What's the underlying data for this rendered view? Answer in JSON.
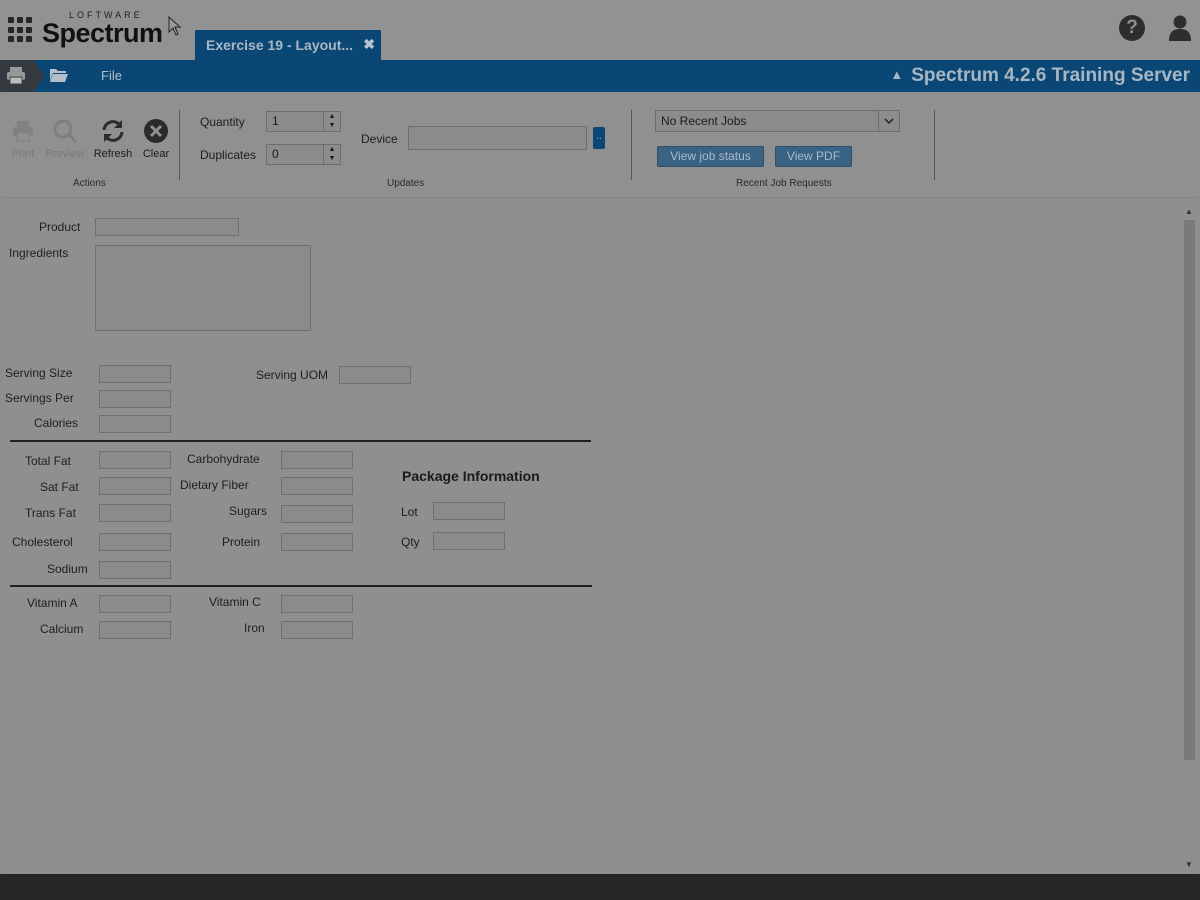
{
  "header": {
    "logo_small": "LOFTWARE",
    "logo_main": "Spectrum",
    "tab_title": "Exercise 19 - Layout...",
    "tab_close": "✖",
    "help_glyph": "?"
  },
  "ribbon": {
    "file_label": "File",
    "server_title": "Spectrum 4.2.6 Training Server",
    "collapse_glyph": "^"
  },
  "toolbar": {
    "actions": {
      "print_label": "Print",
      "preview_label": "Preview",
      "refresh_label": "Refresh",
      "clear_label": "Clear",
      "group_label": "Actions"
    },
    "updates": {
      "quantity_label": "Quantity",
      "quantity_value": "1",
      "duplicates_label": "Duplicates",
      "duplicates_value": "0",
      "device_label": "Device",
      "device_browse": "..",
      "group_label": "Updates"
    },
    "recent": {
      "selected": "No Recent Jobs",
      "view_status": "View job status",
      "view_pdf": "View PDF",
      "group_label": "Recent Job Requests"
    }
  },
  "form": {
    "product": "Product",
    "ingredients": "Ingredients",
    "serving_size": "Serving Size",
    "serving_uom": "Serving UOM",
    "servings_per": "Servings Per",
    "calories": "Calories",
    "total_fat": "Total Fat",
    "carbohydrate": "Carbohydrate",
    "sat_fat": "Sat Fat",
    "dietary_fiber": "Dietary Fiber",
    "trans_fat": "Trans Fat",
    "sugars": "Sugars",
    "cholesterol": "Cholesterol",
    "protein": "Protein",
    "sodium": "Sodium",
    "vitamin_a": "Vitamin A",
    "vitamin_c": "Vitamin C",
    "calcium": "Calcium",
    "iron": "Iron",
    "package_heading": "Package Information",
    "lot": "Lot",
    "qty": "Qty"
  },
  "icons": {
    "apps": "apps-grid-icon",
    "help": "help-icon",
    "user": "user-icon",
    "print": "printer-icon",
    "folder": "folder-open-icon"
  }
}
